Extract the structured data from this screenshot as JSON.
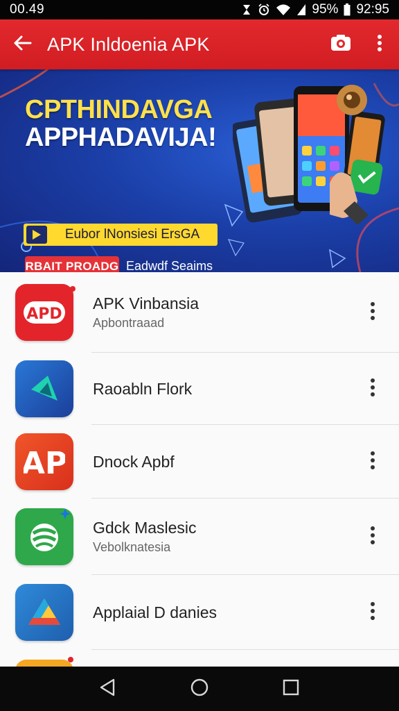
{
  "status_bar": {
    "time_left": "00.49",
    "battery": "95%",
    "clock": "92:95"
  },
  "app_bar": {
    "title": "APK Inldoenia APK",
    "back_icon": "arrow-left-icon",
    "action_icon": "camera-icon",
    "menu_icon": "more-vert-icon"
  },
  "banner": {
    "headline_line1": "CPTHINDAVGA",
    "headline_line2": "APPHADAVIJA!",
    "promo_text": "Eubor lNonsiesi ErsGA",
    "cta_label": "RBAIT PROADG",
    "cta_sub": "Eadwdf Seaims"
  },
  "apps": [
    {
      "title": "APK Vinbansia",
      "subtitle": "Apbontraaad",
      "icon": "apk-app-icon",
      "color": "#e3252b"
    },
    {
      "title": "Raoabln Flork",
      "subtitle": "",
      "icon": "play-triangle-app-icon",
      "color": "#1e5bb8"
    },
    {
      "title": "Dnock Apbf",
      "subtitle": "",
      "icon": "ap-letter-app-icon",
      "color": "#e8461f"
    },
    {
      "title": "Gdck Maslesic",
      "subtitle": "Vebolknatesia",
      "icon": "green-swirl-app-icon",
      "color": "#2ea84a"
    },
    {
      "title": "Applaial D danies",
      "subtitle": "",
      "icon": "drive-triangle-app-icon",
      "color": "#2776c9"
    }
  ],
  "nav_bar": {
    "back": "back-triangle-icon",
    "home": "home-circle-icon",
    "recents": "recents-square-icon"
  },
  "colors": {
    "accent": "#e2292d",
    "banner_blue": "#1b3fa8",
    "headline_yellow": "#ffe14a"
  }
}
